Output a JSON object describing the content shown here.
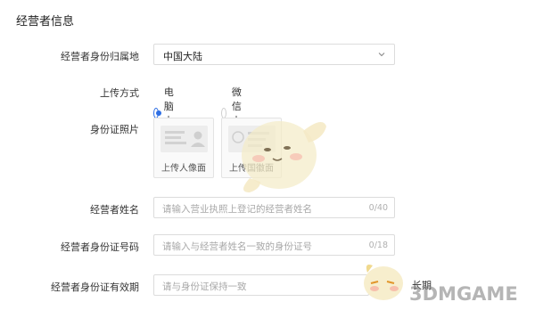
{
  "section": {
    "title": "经营者信息"
  },
  "fields": {
    "region": {
      "label": "经营者身份归属地",
      "value": "中国大陆"
    },
    "upload_method": {
      "label": "上传方式",
      "options": [
        "电脑上传",
        "微信上传"
      ],
      "selected": "电脑上传"
    },
    "id_photo": {
      "label": "身份证照片",
      "front_caption": "上传人像面",
      "back_caption": "上传国徽面"
    },
    "name": {
      "label": "经营者姓名",
      "placeholder": "请输入营业执照上登记的经营者姓名",
      "counter": "0/40"
    },
    "id_number": {
      "label": "经营者身份证号码",
      "placeholder": "请输入与经营者姓名一致的身份证号",
      "counter": "0/18"
    },
    "id_validity": {
      "label": "经营者身份证有效期",
      "placeholder": "请与身份证保持一致",
      "long_term_label": "长期"
    }
  },
  "watermark": {
    "text": "3DMGAME"
  },
  "colors": {
    "accent": "#2f6fe4",
    "border": "#dcdcdc",
    "placeholder": "#a8a8a8"
  },
  "icons": {
    "select": "chevron-down-icon",
    "card_front": "id-card-portrait-icon",
    "card_back": "id-card-emblem-icon"
  }
}
